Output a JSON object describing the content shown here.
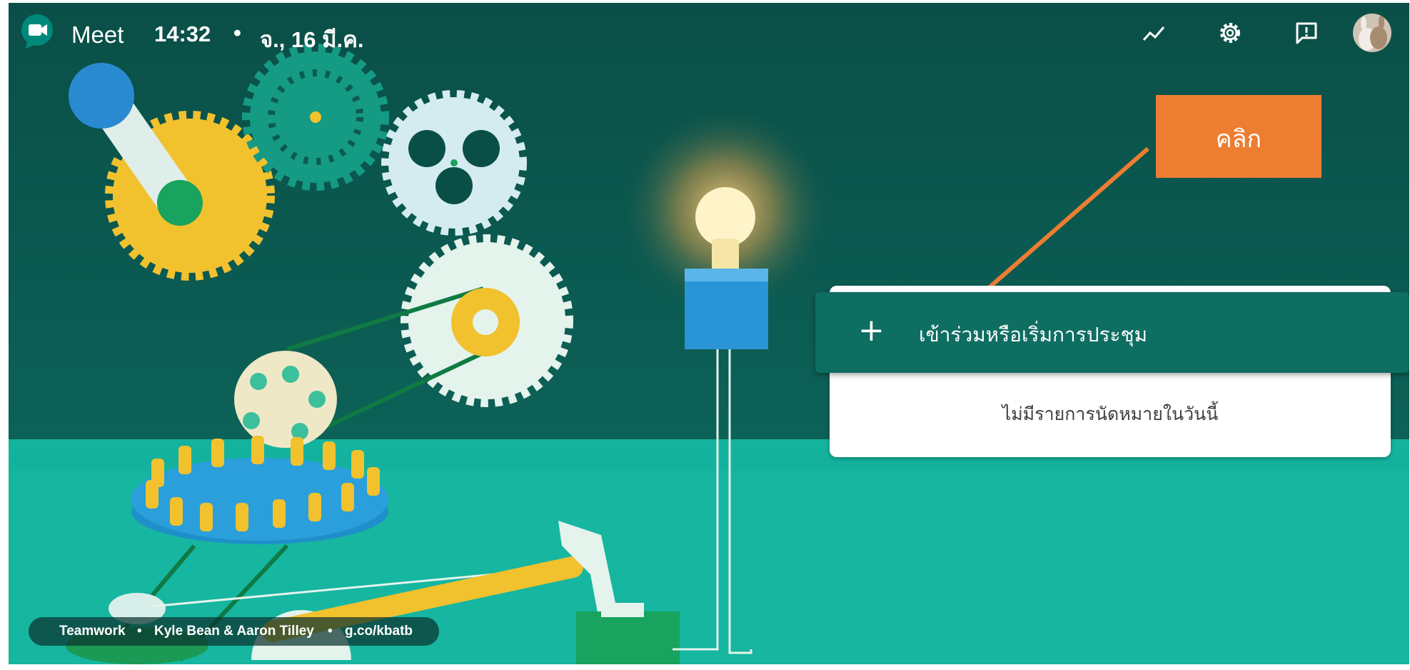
{
  "app": {
    "name": "Meet"
  },
  "header": {
    "time": "14:32",
    "separator": "•",
    "date": "จ., 16 มี.ค."
  },
  "toolbar_icons": [
    "activity-chart-icon",
    "gear-icon",
    "feedback-icon",
    "avatar"
  ],
  "main": {
    "join_button": {
      "icon": "plus",
      "label": "เข้าร่วมหรือเริ่มการประชุม"
    },
    "empty_message": "ไม่มีรายการนัดหมายในวันนี้"
  },
  "annotation": {
    "label": "คลิก",
    "color": "#ed7d31"
  },
  "background_credit": {
    "title": "Teamwork",
    "separator": "•",
    "authors": "Kyle Bean & Aaron Tilley",
    "link": "g.co/kbatb"
  },
  "colors": {
    "wall_dark": "#0a4f47",
    "floor_teal": "#14b39e",
    "join_button": "#0e6e62",
    "callout_orange": "#ed7d31",
    "gear_yellow": "#f2c12e",
    "gear_teal": "#159a84"
  }
}
